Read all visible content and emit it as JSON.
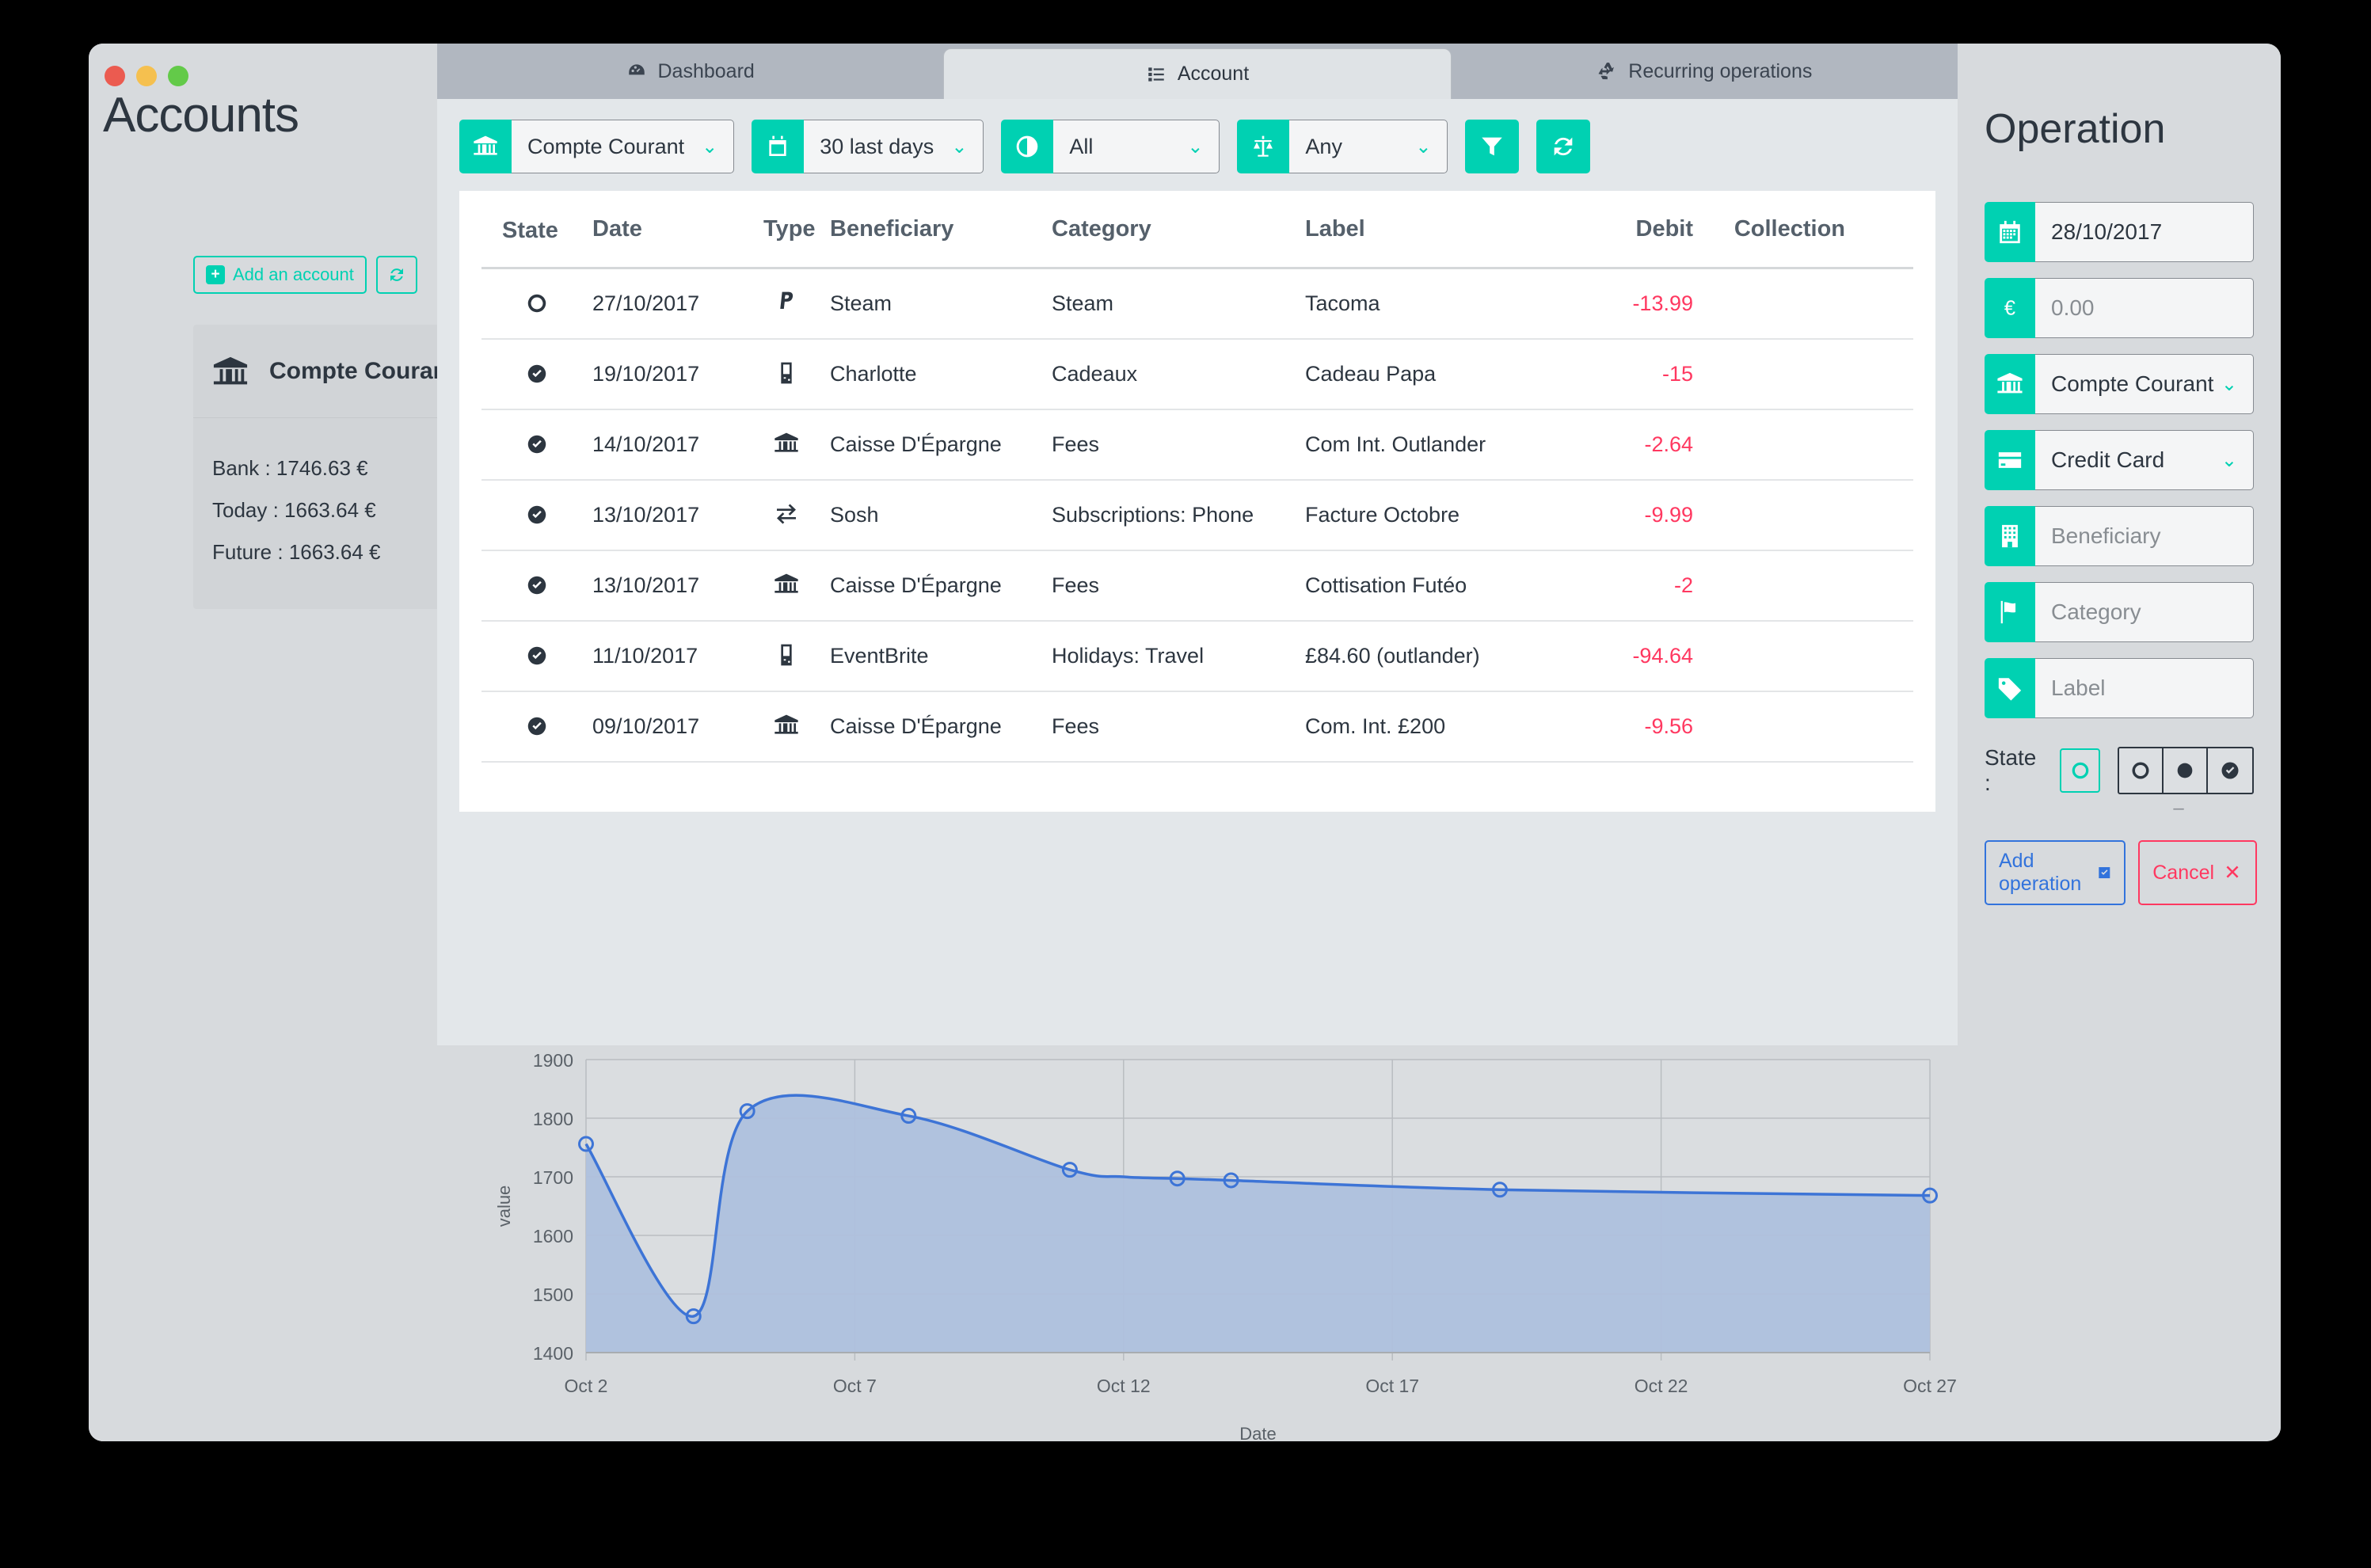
{
  "app": {
    "title": "Accounts"
  },
  "sidebar": {
    "add_account_label": "Add an account",
    "refresh_icon": "refresh-icon",
    "account": {
      "name": "Compte Courant",
      "bank": "Bank : 1746.63  €",
      "today": "Today : 1663.64  €",
      "future": "Future : 1663.64  €"
    }
  },
  "tabs": [
    {
      "label": "Dashboard",
      "icon": "dashboard-icon",
      "active": false
    },
    {
      "label": "Account",
      "icon": "list-icon",
      "active": true
    },
    {
      "label": "Recurring operations",
      "icon": "recycle-icon",
      "active": false
    }
  ],
  "filters": {
    "account": "Compte Courant",
    "period": "30 last days",
    "state": "All",
    "type": "Any",
    "filter_icon": "funnel-icon",
    "refresh_icon": "refresh-icon"
  },
  "table": {
    "headers": [
      "State",
      "Date",
      "Type",
      "Beneficiary",
      "Category",
      "Label",
      "Debit",
      "Collection"
    ],
    "rows": [
      {
        "state": "pending",
        "date": "27/10/2017",
        "type": "paypal",
        "beneficiary": "Steam",
        "category": "Steam",
        "label": "Tacoma",
        "debit": "-13.99",
        "collection": ""
      },
      {
        "state": "done",
        "date": "19/10/2017",
        "type": "card",
        "beneficiary": "Charlotte",
        "category": "Cadeaux",
        "label": "Cadeau Papa",
        "debit": "-15",
        "collection": ""
      },
      {
        "state": "done",
        "date": "14/10/2017",
        "type": "bank",
        "beneficiary": "Caisse D'Épargne",
        "category": "Fees",
        "label": "Com Int. Outlander",
        "debit": "-2.64",
        "collection": ""
      },
      {
        "state": "done",
        "date": "13/10/2017",
        "type": "transfer",
        "beneficiary": "Sosh",
        "category": "Subscriptions: Phone",
        "label": "Facture Octobre",
        "debit": "-9.99",
        "collection": ""
      },
      {
        "state": "done",
        "date": "13/10/2017",
        "type": "bank",
        "beneficiary": "Caisse D'Épargne",
        "category": "Fees",
        "label": "Cottisation Futéo",
        "debit": "-2",
        "collection": ""
      },
      {
        "state": "done",
        "date": "11/10/2017",
        "type": "card",
        "beneficiary": "EventBrite",
        "category": "Holidays: Travel",
        "label": "£84.60 (outlander)",
        "debit": "-94.64",
        "collection": ""
      },
      {
        "state": "done",
        "date": "09/10/2017",
        "type": "bank",
        "beneficiary": "Caisse D'Épargne",
        "category": "Fees",
        "label": "Com. Int. £200",
        "debit": "-9.56",
        "collection": ""
      }
    ]
  },
  "operation": {
    "title": "Operation",
    "date": "28/10/2017",
    "amount_placeholder": "0.00",
    "account": "Compte Courant",
    "payment_type": "Credit Card",
    "beneficiary_placeholder": "Beneficiary",
    "category_placeholder": "Category",
    "label_placeholder": "Label",
    "state_label": "State :",
    "state_dash": "–",
    "state_options": [
      "pending",
      "filled",
      "done"
    ],
    "add_label": "Add operation",
    "cancel_label": "Cancel"
  },
  "colors": {
    "accent": "#00d1b2",
    "debit": "#ff3860",
    "primary": "#3273dc",
    "chart_line": "#3d74d6"
  },
  "chart_data": {
    "type": "area",
    "title": "",
    "xlabel": "Date",
    "ylabel": "value",
    "ylim": [
      1400,
      1900
    ],
    "yticks": [
      1400,
      1500,
      1600,
      1700,
      1800,
      1900
    ],
    "xticks": [
      "Oct 2",
      "Oct 7",
      "Oct 12",
      "Oct 17",
      "Oct 22",
      "Oct 27"
    ],
    "grid": true,
    "legend": "none",
    "x": [
      "Oct 2",
      "Oct 4",
      "Oct 5",
      "Oct 8",
      "Oct 11",
      "Oct 12",
      "Oct 13",
      "Oct 14",
      "Oct 19",
      "Oct 27"
    ],
    "values": [
      1756,
      1462,
      1812,
      1804,
      1712,
      1700,
      1697,
      1694,
      1678,
      1668
    ],
    "markers": [
      {
        "x": "Oct 2",
        "y": 1756
      },
      {
        "x": "Oct 4",
        "y": 1462
      },
      {
        "x": "Oct 5",
        "y": 1812
      },
      {
        "x": "Oct 8",
        "y": 1804
      },
      {
        "x": "Oct 11",
        "y": 1712
      },
      {
        "x": "Oct 13",
        "y": 1697
      },
      {
        "x": "Oct 14",
        "y": 1694
      },
      {
        "x": "Oct 19",
        "y": 1678
      },
      {
        "x": "Oct 27",
        "y": 1668
      }
    ]
  }
}
